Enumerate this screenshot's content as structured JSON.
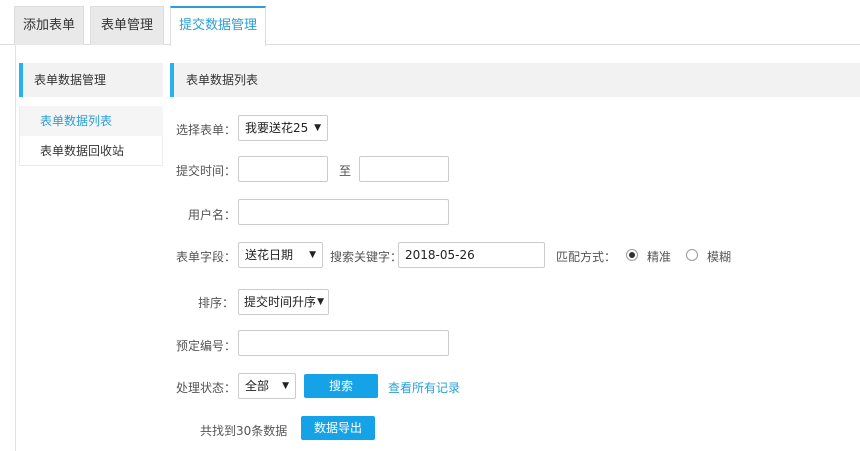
{
  "tabs": [
    "添加表单",
    "表单管理",
    "提交数据管理"
  ],
  "sidebar": {
    "title": "表单数据管理",
    "items": [
      "表单数据列表",
      "表单数据回收站"
    ]
  },
  "main": {
    "title": "表单数据列表",
    "form_select": {
      "label": "选择表单：",
      "value": "我要送花25"
    },
    "submit_time": {
      "label": "提交时间：",
      "separator": "至",
      "start": "",
      "end": ""
    },
    "username": {
      "label": "用户名：",
      "value": ""
    },
    "field": {
      "label": "表单字段：",
      "value": "送花日期",
      "keyword_label": "搜索关键字：",
      "keyword": "2018-05-26",
      "match_label": "匹配方式：",
      "options": [
        "精准",
        "模糊"
      ],
      "selected": "精准"
    },
    "sort": {
      "label": "排序：",
      "value": "提交时间升序"
    },
    "booking_no": {
      "label": "预定编号：",
      "value": ""
    },
    "status": {
      "label": "处理状态：",
      "value": "全部"
    },
    "search_button": "搜索",
    "view_all_link": "查看所有记录",
    "result_text": "共找到30条数据",
    "export_button": "数据导出"
  },
  "colors": {
    "accent": "#16a2e6",
    "link": "#2a9fd6"
  }
}
